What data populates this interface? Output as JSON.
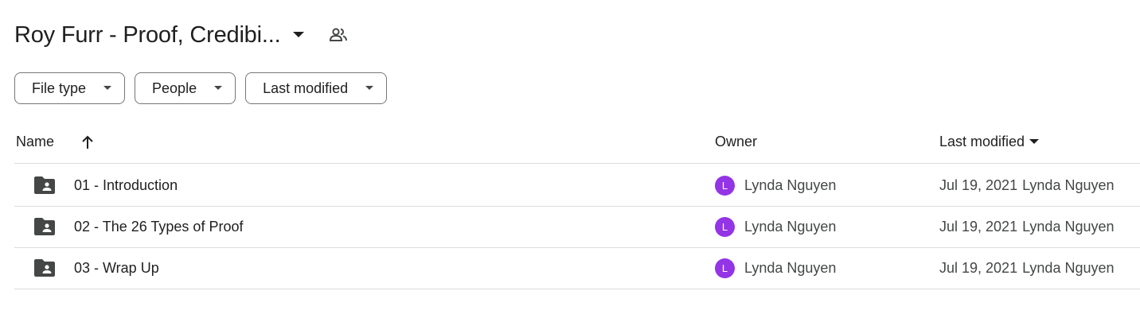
{
  "header": {
    "title": "Roy Furr - Proof, Credibi...",
    "title_dropdown_icon": "caret-down-icon",
    "shared_icon": "people-icon"
  },
  "filters": [
    {
      "label": "File type"
    },
    {
      "label": "People"
    },
    {
      "label": "Last modified"
    }
  ],
  "table": {
    "columns": {
      "name": "Name",
      "owner": "Owner",
      "last_modified": "Last modified"
    },
    "sort": {
      "column": "Name",
      "direction": "ascending",
      "icon": "arrow-up-icon"
    },
    "rows": [
      {
        "name": "01 - Introduction",
        "owner_initial": "L",
        "owner": "Lynda Nguyen",
        "modified_date": "Jul 19, 2021",
        "modified_by": "Lynda Nguyen"
      },
      {
        "name": "02 - The 26 Types of Proof",
        "owner_initial": "L",
        "owner": "Lynda Nguyen",
        "modified_date": "Jul 19, 2021",
        "modified_by": "Lynda Nguyen"
      },
      {
        "name": "03 - Wrap Up",
        "owner_initial": "L",
        "owner": "Lynda Nguyen",
        "modified_date": "Jul 19, 2021",
        "modified_by": "Lynda Nguyen"
      }
    ]
  },
  "colors": {
    "avatar": "#9334e6",
    "divider": "#dadce0",
    "chip_border": "#747775",
    "folder_icon": "#444746"
  }
}
